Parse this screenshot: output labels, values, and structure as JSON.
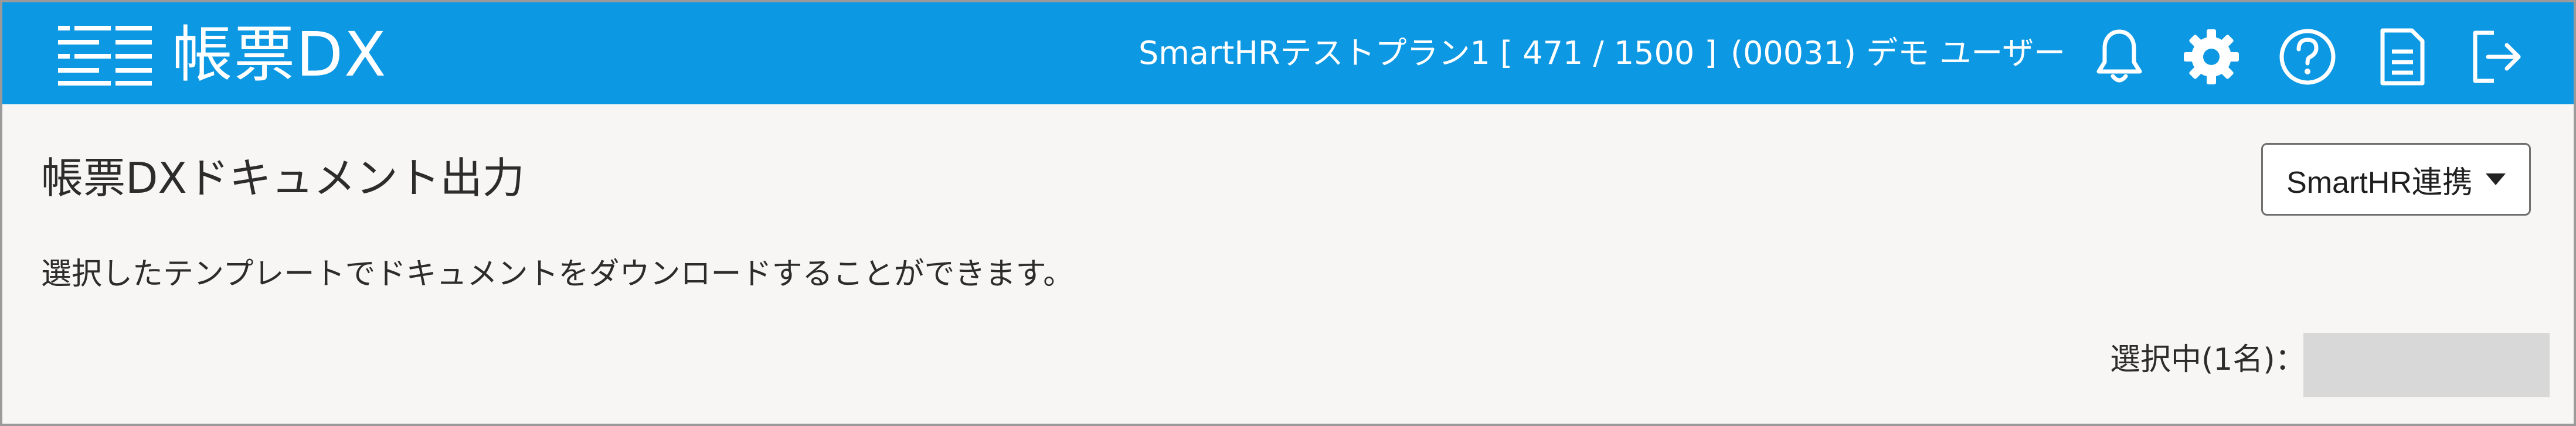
{
  "header": {
    "logo_text": "帳票DX",
    "plan_text": "SmartHRテストプラン1 [ 471 / 1500 ]",
    "user_text": "(00031) デモ ユーザー",
    "icons": [
      "bell-icon",
      "gear-icon",
      "help-icon",
      "document-icon",
      "logout-icon"
    ]
  },
  "main": {
    "title": "帳票DXドキュメント出力",
    "sync_button_label": "SmartHR連携",
    "description": "選択したテンプレートでドキュメントをダウンロードすることができます。",
    "selected_label": "選択中(1名)："
  },
  "colors": {
    "header_bg": "#0d98e3",
    "page_bg": "#f7f6f4",
    "placeholder_block": "#d8d8d8"
  }
}
